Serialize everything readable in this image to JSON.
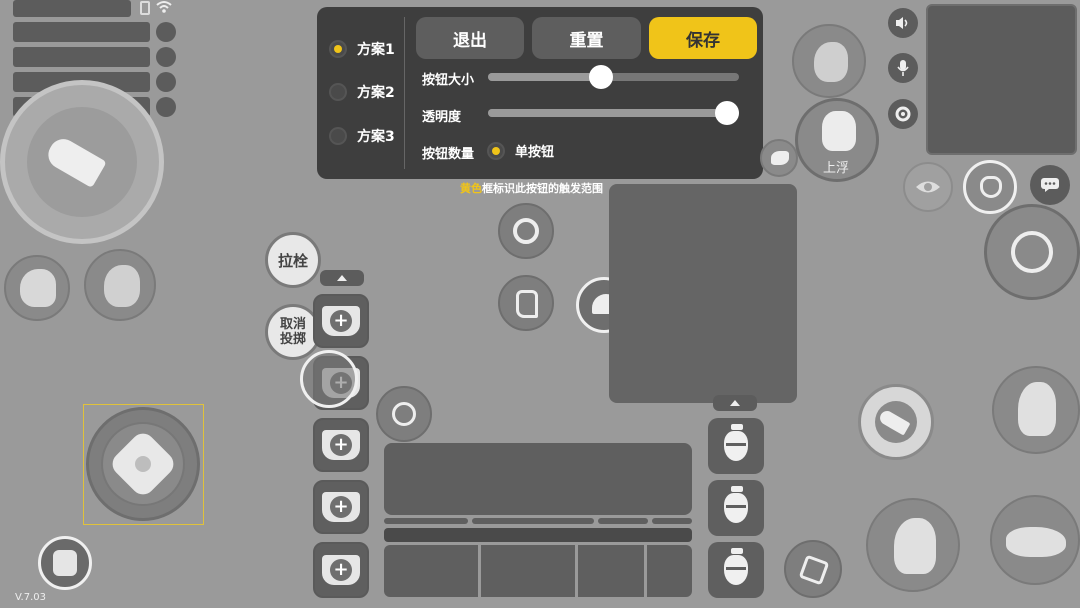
{
  "version": "V.7.03",
  "settings_panel": {
    "schemes": [
      {
        "label": "方案1",
        "selected": true
      },
      {
        "label": "方案2",
        "selected": false
      },
      {
        "label": "方案3",
        "selected": false
      }
    ],
    "exit_label": "退出",
    "reset_label": "重置",
    "save_label": "保存",
    "button_size_label": "按钮大小",
    "button_size_value": 0.45,
    "opacity_label": "透明度",
    "opacity_value": 1.0,
    "button_count_label": "按钮数量",
    "button_count_option": "单按钮"
  },
  "hint": {
    "highlight": "黄色",
    "rest": "框标识此按钮的触发范围"
  },
  "buttons": {
    "bolt_label": "拉栓",
    "cancel_throw_label": "取消\n投掷",
    "float_label": "上浮"
  },
  "colors": {
    "accent": "#f0c419",
    "panel_bg": "#3e3e3e",
    "background": "#9a9a9a"
  }
}
